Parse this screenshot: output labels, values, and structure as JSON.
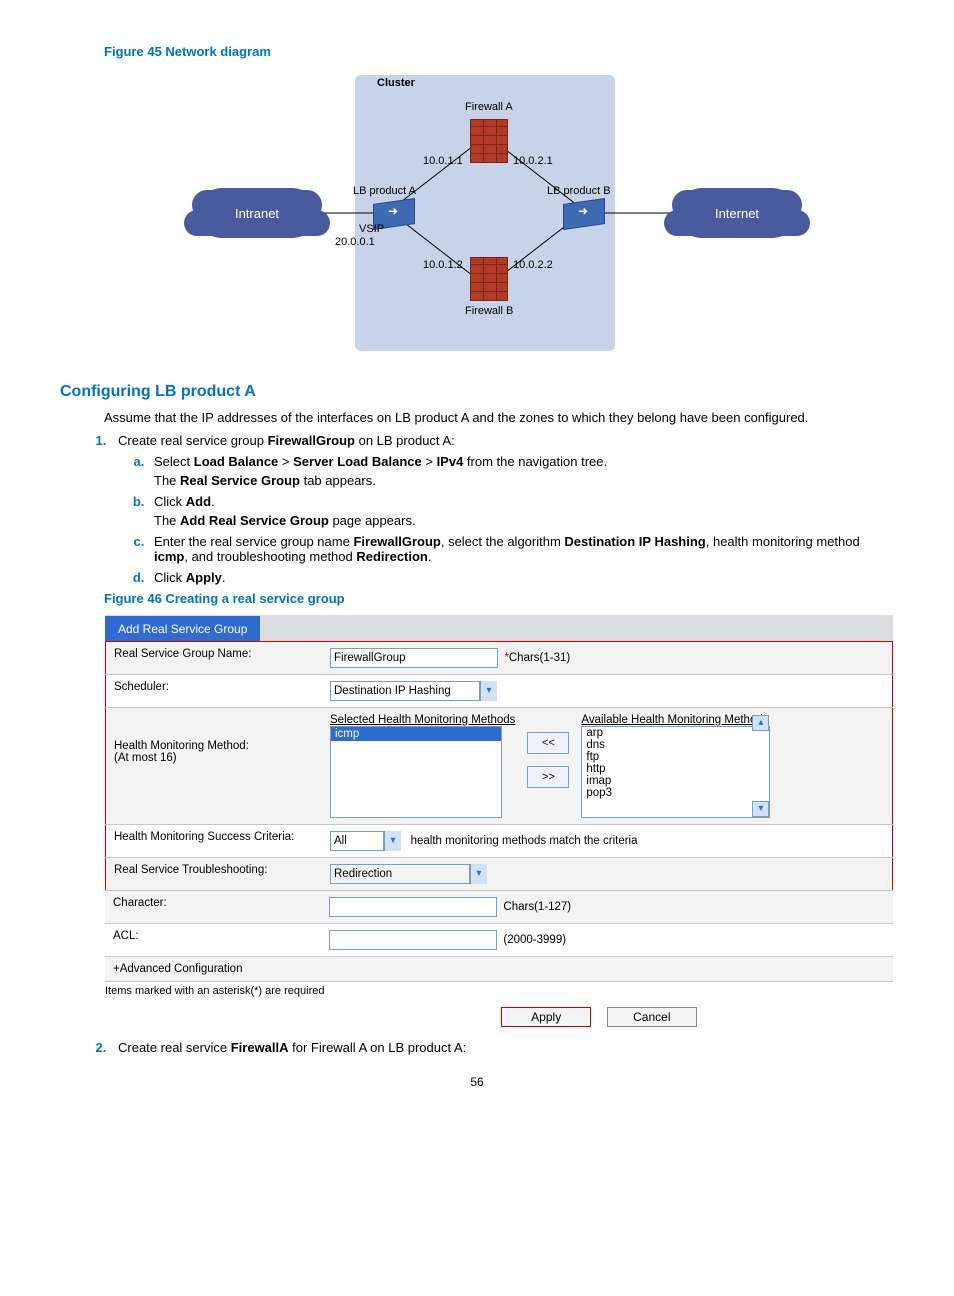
{
  "figure45_title": "Figure 45 Network diagram",
  "diagram": {
    "cluster_label": "Cluster",
    "intranet": "Intranet",
    "internet": "Internet",
    "firewall_a": "Firewall A",
    "firewall_b": "Firewall B",
    "lb_a": "LB product A",
    "lb_b": "LB product B",
    "vsip_label": "VSIP",
    "vsip_ip": "20.0.0.1",
    "ip_fa_left": "10.0.1.1",
    "ip_fa_right": "10.0.2.1",
    "ip_fb_left": "10.0.1.2",
    "ip_fb_right": "10.0.2.2"
  },
  "h2": "Configuring LB product A",
  "intro": "Assume that the IP addresses of the interfaces on LB product A and the zones to which they belong have been configured.",
  "step1_pre": "Create real service group ",
  "step1_bold": "FirewallGroup",
  "step1_post": " on LB product A:",
  "a_pre": "Select ",
  "a_b1": "Load Balance",
  "a_sep": " > ",
  "a_b2": "Server Load Balance",
  "a_b3": "IPv4",
  "a_post": " from the navigation tree.",
  "a_sub_pre": "The ",
  "a_sub_b": "Real Service Group",
  "a_sub_post": " tab appears.",
  "b_pre": "Click ",
  "b_b": "Add",
  "b_post": ".",
  "b_sub_pre": "The ",
  "b_sub_b": "Add Real Service Group",
  "b_sub_post": " page appears.",
  "c_pre": "Enter the real service group name ",
  "c_b1": "FirewallGroup",
  "c_mid1": ", select the algorithm ",
  "c_b2": "Destination IP Hashing",
  "c_mid2": ", health monitoring method ",
  "c_b3": "icmp",
  "c_mid3": ", and troubleshooting method ",
  "c_b4": "Redirection",
  "c_post": ".",
  "d_pre": "Click ",
  "d_b": "Apply",
  "d_post": ".",
  "figure46_title": "Figure 46 Creating a real service group",
  "form": {
    "tab": "Add Real Service Group",
    "name_label": "Real Service Group Name:",
    "name_value": "FirewallGroup",
    "name_hint": "*Chars(1-31)",
    "scheduler_label": "Scheduler:",
    "scheduler_value": "Destination IP Hashing",
    "hm_label_l1": "Health Monitoring Method:",
    "hm_label_l2": "(At most 16)",
    "selected_hdr": "Selected Health Monitoring Methods",
    "available_hdr": "Available Health Monitoring Methods",
    "selected_item": "icmp",
    "available_items": [
      "arp",
      "dns",
      "ftp",
      "http",
      "imap",
      "pop3"
    ],
    "move_left": "<<",
    "move_right": ">>",
    "success_label": "Health Monitoring Success Criteria:",
    "success_value": "All",
    "success_hint": "health monitoring methods match the criteria",
    "trouble_label": "Real Service Troubleshooting:",
    "trouble_value": "Redirection",
    "char_label": "Character:",
    "char_hint": "Chars(1-127)",
    "acl_label": "ACL:",
    "acl_hint": "(2000-3999)",
    "advanced": "+Advanced Configuration",
    "note": "Items marked with an asterisk(*) are required",
    "apply": "Apply",
    "cancel": "Cancel"
  },
  "step2_pre": "Create real service ",
  "step2_bold": "FirewallA",
  "step2_post": " for Firewall A on LB product A:",
  "page_number": "56"
}
